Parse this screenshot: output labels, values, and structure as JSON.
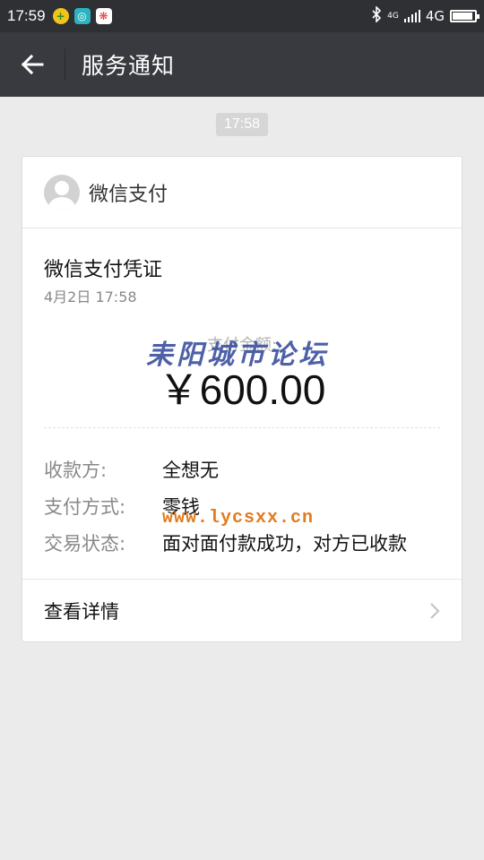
{
  "status_bar": {
    "time": "17:59",
    "network_small": "4G",
    "network": "4G",
    "battery_level": 0.9,
    "icons": [
      "gold-coin-icon",
      "scan-icon",
      "colorful-app-icon",
      "bluetooth-icon",
      "signal-icon",
      "battery-icon"
    ]
  },
  "title_bar": {
    "title": "服务通知",
    "back_icon": "arrow-left-icon"
  },
  "timestamp": "17:58",
  "card": {
    "sender": "微信支付",
    "title": "微信支付凭证",
    "date": "4月2日  17:58",
    "amount_label": "支付金额:",
    "amount": "￥600.00",
    "rows": [
      {
        "label": "收款方:",
        "value": "全想无"
      },
      {
        "label": "支付方式:",
        "value": "零钱"
      },
      {
        "label": "交易状态:",
        "value": "面对面付款成功，对方已收款"
      }
    ],
    "footer_label": "查看详情"
  },
  "watermark": {
    "text": "耒阳城市论坛",
    "url": "www.lycsxx.cn"
  },
  "colors": {
    "status_bar": "#2e3033",
    "title_bar": "#393a3f",
    "background": "#ebebeb",
    "watermark_text": "#3b4f9e",
    "watermark_url": "#e07c1e"
  }
}
